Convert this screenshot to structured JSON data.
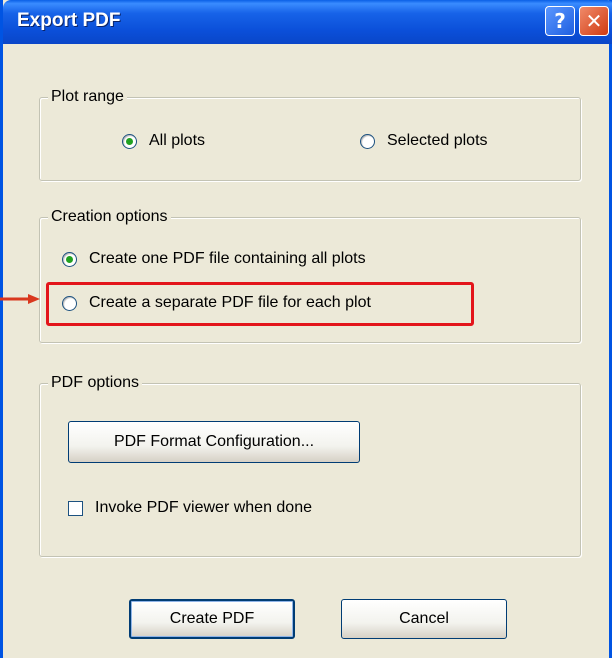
{
  "window": {
    "title": "Export PDF",
    "help_glyph": "?",
    "close_glyph": "✕"
  },
  "plot_range": {
    "legend": "Plot range",
    "options": [
      {
        "label": "All plots",
        "checked": true
      },
      {
        "label": "Selected plots",
        "checked": false
      }
    ]
  },
  "creation_options": {
    "legend": "Creation options",
    "options": [
      {
        "label": "Create one PDF file containing all plots",
        "checked": true
      },
      {
        "label": "Create a separate PDF file for each plot",
        "checked": false
      }
    ]
  },
  "pdf_options": {
    "legend": "PDF options",
    "format_button": "PDF Format Configuration...",
    "invoke_viewer": {
      "label": "Invoke PDF viewer when done",
      "checked": false
    }
  },
  "footer": {
    "create_label": "Create PDF",
    "cancel_label": "Cancel"
  },
  "colors": {
    "titlebar": "#0b4fd9",
    "dialog_bg": "#ece9d8",
    "highlight": "#e3151b",
    "arrow": "#d9381e"
  }
}
